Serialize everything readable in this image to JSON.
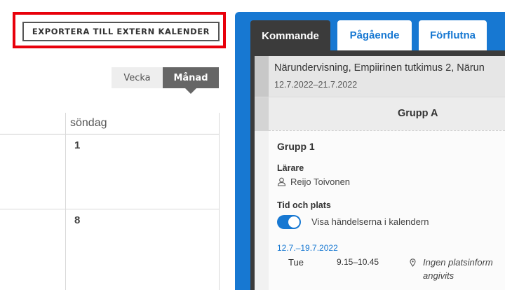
{
  "export_button": {
    "label": "EXPORTERA TILL EXTERN KALENDER"
  },
  "view_toggle": {
    "week": "Vecka",
    "month": "Månad",
    "selected": "Månad"
  },
  "calendar": {
    "visible_column_header": "söndag",
    "days": [
      "1",
      "8"
    ]
  },
  "panel": {
    "tabs": [
      {
        "label": "Kommande",
        "active": true
      },
      {
        "label": "Pågående",
        "active": false
      },
      {
        "label": "Förflutna",
        "active": false
      }
    ],
    "course": {
      "title": "Närundervisning, Empiirinen tutkimus 2, Närun",
      "dates": "12.7.2022–21.7.2022",
      "group_bar": "Grupp A"
    },
    "group": {
      "name": "Grupp 1",
      "teacher_heading": "Lärare",
      "teacher_name": "Reijo Toivonen",
      "time_place_heading": "Tid och plats",
      "toggle_label": "Visa händelserna i kalendern",
      "toggle_on": true,
      "date_range": "12.7.–19.7.2022",
      "schedule": {
        "weekday": "Tue",
        "time": "9.15–10.45",
        "location_line1": "Ingen platsinform",
        "location_line2": "angivits"
      }
    }
  },
  "colors": {
    "accent": "#1778d2",
    "highlight": "#e8000b",
    "dark": "#3b3b3b"
  }
}
